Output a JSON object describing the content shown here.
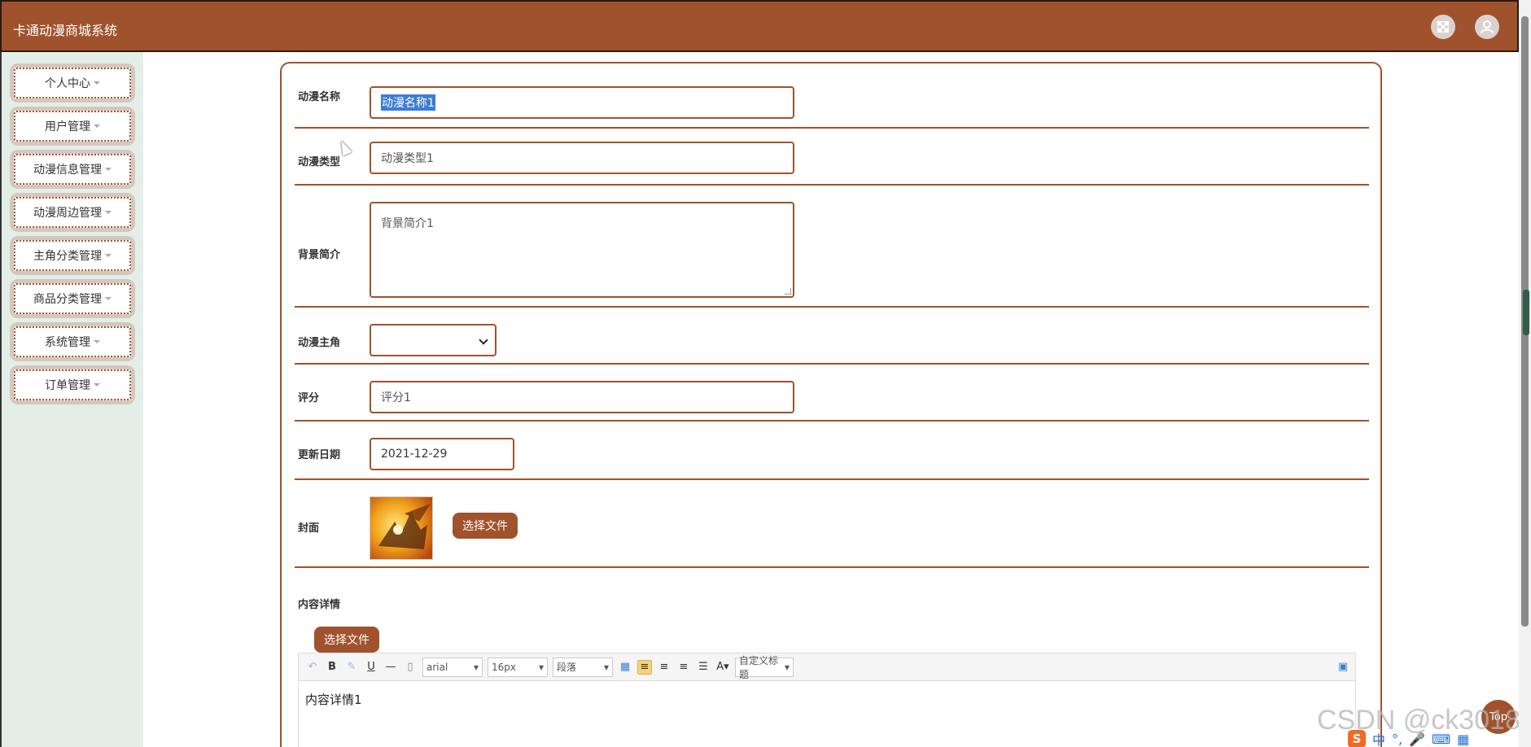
{
  "header": {
    "title": "卡通动漫商城系统",
    "colors": {
      "primary": "#a0522d",
      "sidebar_bg": "#e3eee8"
    },
    "icons": [
      "fullscreen-icon",
      "user-icon"
    ]
  },
  "sidebar": {
    "items": [
      {
        "label": "个人中心"
      },
      {
        "label": "用户管理"
      },
      {
        "label": "动漫信息管理"
      },
      {
        "label": "动漫周边管理"
      },
      {
        "label": "主角分类管理"
      },
      {
        "label": "商品分类管理"
      },
      {
        "label": "系统管理"
      },
      {
        "label": "订单管理"
      }
    ]
  },
  "form": {
    "name": {
      "label": "动漫名称",
      "value": "动漫名称1"
    },
    "type": {
      "label": "动漫类型",
      "value": "动漫类型1"
    },
    "background": {
      "label": "背景简介",
      "value": "背景简介1"
    },
    "protagonist": {
      "label": "动漫主角",
      "value": ""
    },
    "score": {
      "label": "评分",
      "value": "评分1"
    },
    "update_date": {
      "label": "更新日期",
      "value": "2021-12-29"
    },
    "cover": {
      "label": "封面",
      "button": "选择文件"
    },
    "detail": {
      "label": "内容详情",
      "button": "选择文件",
      "font": "arial",
      "font_size": "16px",
      "paragraph": "段落",
      "custom_title": "自定义标题",
      "content": "内容详情1"
    }
  },
  "misc": {
    "top_button": "Top",
    "watermark": "CSDN @ck3018",
    "ime": {
      "logo": "S",
      "lang": "中"
    }
  }
}
